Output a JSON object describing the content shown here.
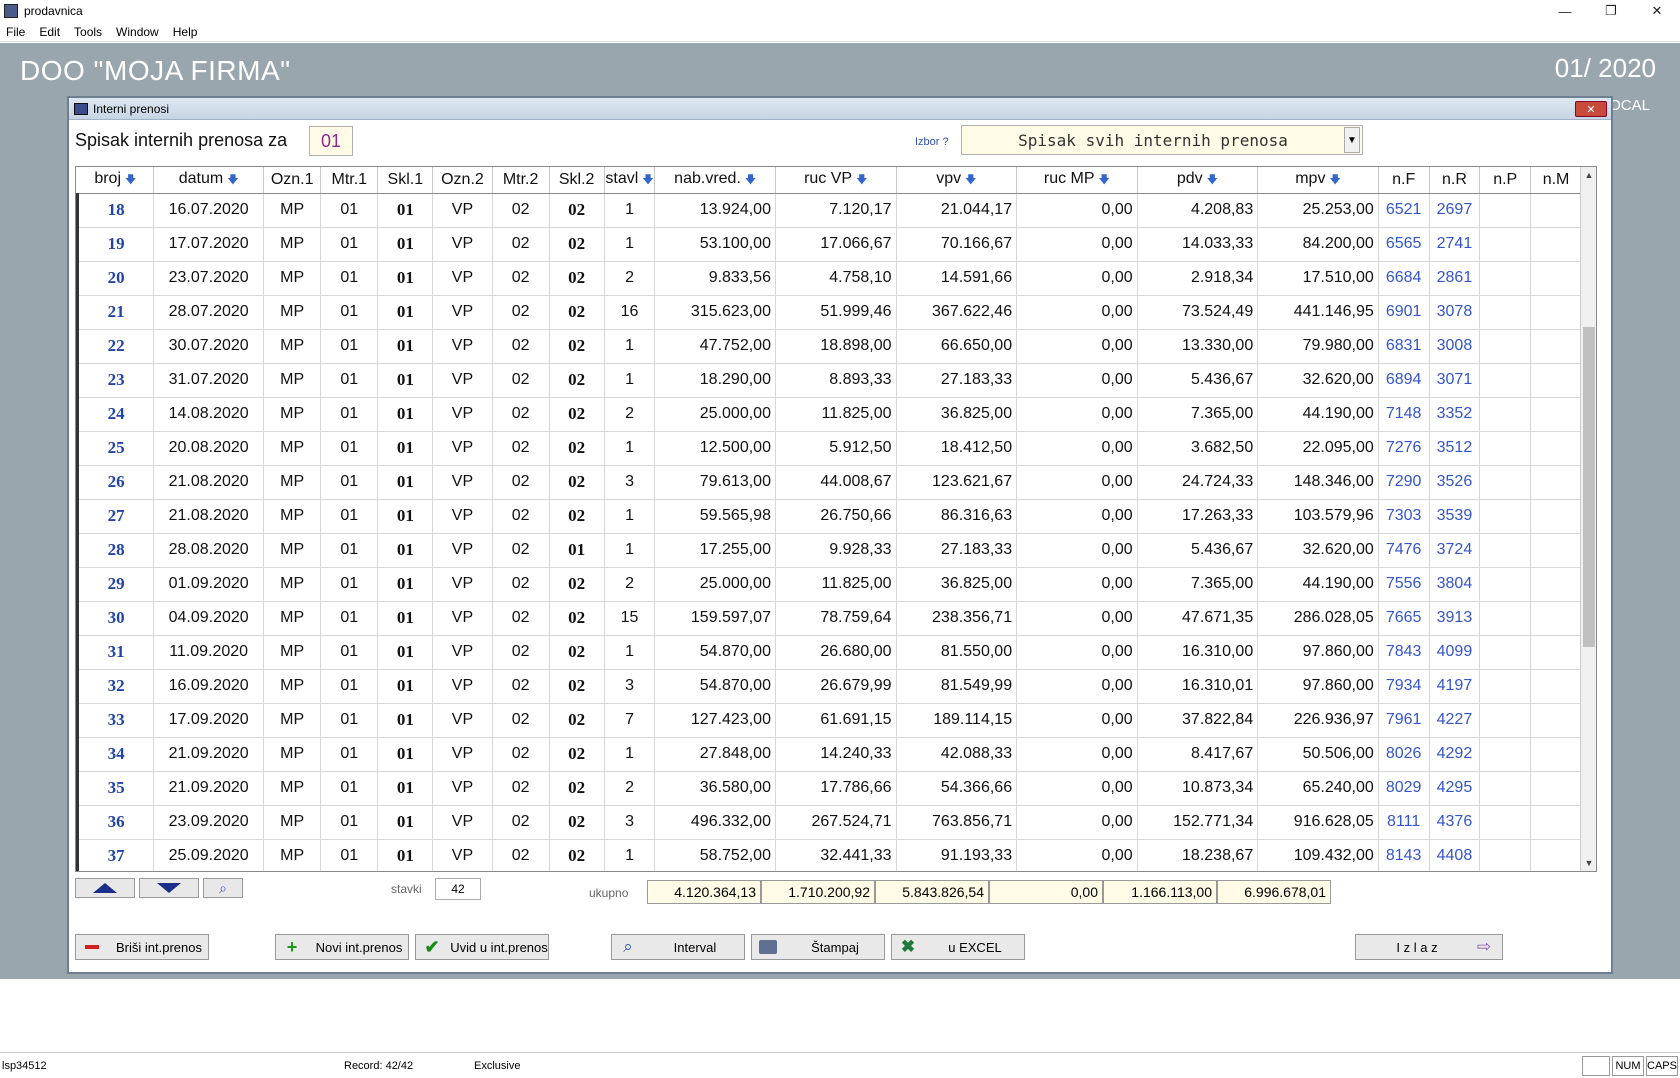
{
  "os": {
    "app_title": "prodavnica",
    "menu": [
      "File",
      "Edit",
      "Tools",
      "Window",
      "Help"
    ],
    "minimize_glyph": "—",
    "restore_glyph": "❐",
    "close_glyph": "✕"
  },
  "desktop": {
    "company": "DOO  \"MOJA FIRMA\"",
    "period": "01/ 2020",
    "local": "OCAL"
  },
  "window": {
    "title": "Interni prenosi",
    "close_glyph": "✕",
    "header_label": "Spisak internih prenosa za",
    "month": "01",
    "izbor_label": "Izbor ?",
    "izbor_value": "Spisak svih internih prenosa",
    "columns": [
      "broj",
      "datum",
      "Ozn.1",
      "Mtr.1",
      "Skl.1",
      "Ozn.2",
      "Mtr.2",
      "Skl.2",
      "stavl",
      "nab.vred.",
      "ruc VP",
      "vpv",
      "ruc MP",
      "pdv",
      "mpv",
      "n.F",
      "n.R",
      "n.P",
      "n.M"
    ],
    "rows": [
      [
        "18",
        "16.07.2020",
        "MP",
        "01",
        "01",
        "VP",
        "02",
        "02",
        "1",
        "13.924,00",
        "7.120,17",
        "21.044,17",
        "0,00",
        "4.208,83",
        "25.253,00",
        "6521",
        "2697",
        "",
        ""
      ],
      [
        "19",
        "17.07.2020",
        "MP",
        "01",
        "01",
        "VP",
        "02",
        "02",
        "1",
        "53.100,00",
        "17.066,67",
        "70.166,67",
        "0,00",
        "14.033,33",
        "84.200,00",
        "6565",
        "2741",
        "",
        ""
      ],
      [
        "20",
        "23.07.2020",
        "MP",
        "01",
        "01",
        "VP",
        "02",
        "02",
        "2",
        "9.833,56",
        "4.758,10",
        "14.591,66",
        "0,00",
        "2.918,34",
        "17.510,00",
        "6684",
        "2861",
        "",
        ""
      ],
      [
        "21",
        "28.07.2020",
        "MP",
        "01",
        "01",
        "VP",
        "02",
        "02",
        "16",
        "315.623,00",
        "51.999,46",
        "367.622,46",
        "0,00",
        "73.524,49",
        "441.146,95",
        "6901",
        "3078",
        "",
        ""
      ],
      [
        "22",
        "30.07.2020",
        "MP",
        "01",
        "01",
        "VP",
        "02",
        "02",
        "1",
        "47.752,00",
        "18.898,00",
        "66.650,00",
        "0,00",
        "13.330,00",
        "79.980,00",
        "6831",
        "3008",
        "",
        ""
      ],
      [
        "23",
        "31.07.2020",
        "MP",
        "01",
        "01",
        "VP",
        "02",
        "02",
        "1",
        "18.290,00",
        "8.893,33",
        "27.183,33",
        "0,00",
        "5.436,67",
        "32.620,00",
        "6894",
        "3071",
        "",
        ""
      ],
      [
        "24",
        "14.08.2020",
        "MP",
        "01",
        "01",
        "VP",
        "02",
        "02",
        "2",
        "25.000,00",
        "11.825,00",
        "36.825,00",
        "0,00",
        "7.365,00",
        "44.190,00",
        "7148",
        "3352",
        "",
        ""
      ],
      [
        "25",
        "20.08.2020",
        "MP",
        "01",
        "01",
        "VP",
        "02",
        "02",
        "1",
        "12.500,00",
        "5.912,50",
        "18.412,50",
        "0,00",
        "3.682,50",
        "22.095,00",
        "7276",
        "3512",
        "",
        ""
      ],
      [
        "26",
        "21.08.2020",
        "MP",
        "01",
        "01",
        "VP",
        "02",
        "02",
        "3",
        "79.613,00",
        "44.008,67",
        "123.621,67",
        "0,00",
        "24.724,33",
        "148.346,00",
        "7290",
        "3526",
        "",
        ""
      ],
      [
        "27",
        "21.08.2020",
        "MP",
        "01",
        "01",
        "VP",
        "02",
        "02",
        "1",
        "59.565,98",
        "26.750,66",
        "86.316,63",
        "0,00",
        "17.263,33",
        "103.579,96",
        "7303",
        "3539",
        "",
        ""
      ],
      [
        "28",
        "28.08.2020",
        "MP",
        "01",
        "01",
        "VP",
        "02",
        "01",
        "1",
        "17.255,00",
        "9.928,33",
        "27.183,33",
        "0,00",
        "5.436,67",
        "32.620,00",
        "7476",
        "3724",
        "",
        ""
      ],
      [
        "29",
        "01.09.2020",
        "MP",
        "01",
        "01",
        "VP",
        "02",
        "02",
        "2",
        "25.000,00",
        "11.825,00",
        "36.825,00",
        "0,00",
        "7.365,00",
        "44.190,00",
        "7556",
        "3804",
        "",
        ""
      ],
      [
        "30",
        "04.09.2020",
        "MP",
        "01",
        "01",
        "VP",
        "02",
        "02",
        "15",
        "159.597,07",
        "78.759,64",
        "238.356,71",
        "0,00",
        "47.671,35",
        "286.028,05",
        "7665",
        "3913",
        "",
        ""
      ],
      [
        "31",
        "11.09.2020",
        "MP",
        "01",
        "01",
        "VP",
        "02",
        "02",
        "1",
        "54.870,00",
        "26.680,00",
        "81.550,00",
        "0,00",
        "16.310,00",
        "97.860,00",
        "7843",
        "4099",
        "",
        ""
      ],
      [
        "32",
        "16.09.2020",
        "MP",
        "01",
        "01",
        "VP",
        "02",
        "02",
        "3",
        "54.870,00",
        "26.679,99",
        "81.549,99",
        "0,00",
        "16.310,01",
        "97.860,00",
        "7934",
        "4197",
        "",
        ""
      ],
      [
        "33",
        "17.09.2020",
        "MP",
        "01",
        "01",
        "VP",
        "02",
        "02",
        "7",
        "127.423,00",
        "61.691,15",
        "189.114,15",
        "0,00",
        "37.822,84",
        "226.936,97",
        "7961",
        "4227",
        "",
        ""
      ],
      [
        "34",
        "21.09.2020",
        "MP",
        "01",
        "01",
        "VP",
        "02",
        "02",
        "1",
        "27.848,00",
        "14.240,33",
        "42.088,33",
        "0,00",
        "8.417,67",
        "50.506,00",
        "8026",
        "4292",
        "",
        ""
      ],
      [
        "35",
        "21.09.2020",
        "MP",
        "01",
        "01",
        "VP",
        "02",
        "02",
        "2",
        "36.580,00",
        "17.786,66",
        "54.366,66",
        "0,00",
        "10.873,34",
        "65.240,00",
        "8029",
        "4295",
        "",
        ""
      ],
      [
        "36",
        "23.09.2020",
        "MP",
        "01",
        "01",
        "VP",
        "02",
        "02",
        "3",
        "496.332,00",
        "267.524,71",
        "763.856,71",
        "0,00",
        "152.771,34",
        "916.628,05",
        "8111",
        "4376",
        "",
        ""
      ],
      [
        "37",
        "25.09.2020",
        "MP",
        "01",
        "01",
        "VP",
        "02",
        "02",
        "1",
        "58.752,00",
        "32.441,33",
        "91.193,33",
        "0,00",
        "18.238,67",
        "109.432,00",
        "8143",
        "4408",
        "",
        ""
      ]
    ],
    "stavki_label": "stavki",
    "stavki_value": "42",
    "ukupno_label": "ukupno",
    "totals": {
      "nab_vred": "4.120.364,13",
      "ruc_vp": "1.710.200,92",
      "vpv": "5.843.826,54",
      "ruc_mp": "0,00",
      "pdv": "1.166.113,00",
      "mpv": "6.996.678,01"
    },
    "buttons": {
      "delete": "Briši int.prenos",
      "new": "Novi int.prenos",
      "view": "Uvid u  int.prenos",
      "interval": "Interval",
      "print": "Štampaj",
      "excel": "u EXCEL",
      "exit": "I z l a z"
    }
  },
  "status": {
    "user": "lsp34512",
    "record": "Record: 42/42",
    "mode": "Exclusive",
    "num": "NUM",
    "caps": "CAPS"
  },
  "colors": {
    "desktop": "#9aa6ae",
    "link_blue": "#3355cc",
    "total_bg": "#fffbe6"
  }
}
